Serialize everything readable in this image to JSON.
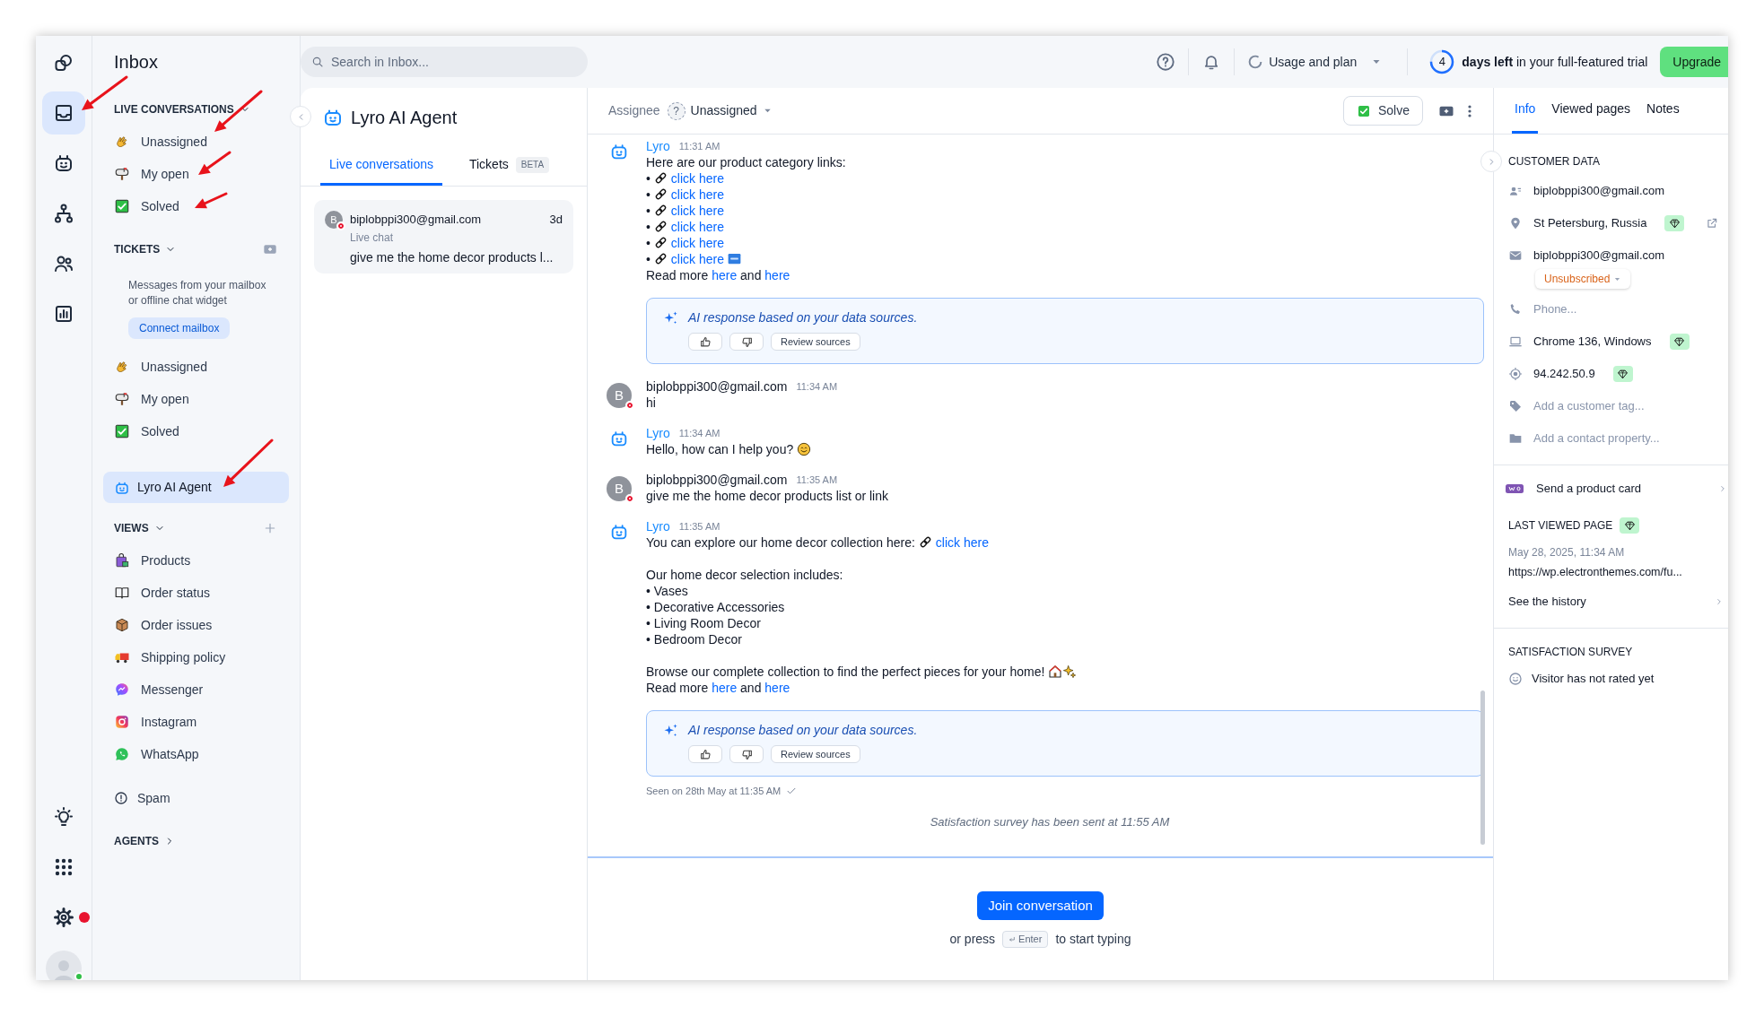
{
  "rail": {
    "top": [
      {
        "kind": "shapes",
        "selected": false
      },
      {
        "kind": "inbox",
        "selected": true
      },
      {
        "kind": "robot",
        "selected": false
      },
      {
        "kind": "flow",
        "selected": false
      },
      {
        "kind": "contacts",
        "selected": false
      },
      {
        "kind": "chart",
        "selected": false
      }
    ],
    "bottom": [
      {
        "kind": "bulb",
        "selected": false,
        "alert": false
      },
      {
        "kind": "apps",
        "selected": false,
        "alert": false
      },
      {
        "kind": "gear",
        "selected": false,
        "alert": true
      }
    ],
    "profile": {
      "online": true
    }
  },
  "sidebar": {
    "title": "Inbox",
    "groups": [
      {
        "kind": "section",
        "heading": "LIVE CONVERSATIONS",
        "expanded": true,
        "items": [
          {
            "label": "Unassigned",
            "kind": "wave",
            "selected": false
          },
          {
            "label": "My open",
            "kind": "mailbox",
            "selected": false
          },
          {
            "label": "Solved",
            "kind": "solved",
            "selected": false
          }
        ]
      },
      {
        "kind": "section",
        "heading": "TICKETS",
        "expanded": true,
        "action": {
          "kind": "add_ticket"
        },
        "note": "Messages from your mailbox or offline chat widget",
        "button": "Connect mailbox",
        "items": [
          {
            "label": "Unassigned",
            "kind": "wave",
            "selected": false
          },
          {
            "label": "My open",
            "kind": "mailbox",
            "selected": false
          },
          {
            "label": "Solved",
            "kind": "solved",
            "selected": false
          }
        ]
      },
      {
        "kind": "agent",
        "label": "Lyro AI Agent",
        "selected": true
      },
      {
        "kind": "section",
        "heading": "VIEWS",
        "expanded": true,
        "action": {
          "kind": "add"
        },
        "items": [
          {
            "label": "Products",
            "kind": "bag",
            "selected": false
          },
          {
            "label": "Order status",
            "kind": "book",
            "selected": false
          },
          {
            "label": "Order issues",
            "kind": "box",
            "selected": false
          },
          {
            "label": "Shipping policy",
            "kind": "truck",
            "selected": false
          },
          {
            "label": "Messenger",
            "kind": "messenger",
            "selected": false
          },
          {
            "label": "Instagram",
            "kind": "instagram",
            "selected": false
          },
          {
            "label": "WhatsApp",
            "kind": "whatsapp",
            "selected": false
          }
        ]
      },
      {
        "kind": "link",
        "label": "Spam"
      },
      {
        "kind": "section",
        "heading": "AGENTS",
        "expanded": false
      }
    ]
  },
  "topbar": {
    "search": {
      "placeholder": "Search in Inbox..."
    },
    "usage": "Usage and plan",
    "trial": {
      "days": "4",
      "level": 0.75,
      "message": "**days left** in your full-featured trial"
    },
    "upgrade": "Upgrade"
  },
  "list": {
    "title": "Lyro AI Agent",
    "tabs": [
      {
        "label": "Live conversations",
        "selected": true
      },
      {
        "label": "Tickets",
        "badge": "BETA",
        "selected": false
      }
    ],
    "conversations": [
      {
        "avatar": "B",
        "online": false,
        "name": "biplobppi300@gmail.com",
        "time": "3d",
        "channel": "Live chat",
        "preview": "give me the home decor products l...",
        "selected": true
      }
    ]
  },
  "chat": {
    "assignee": {
      "label": "Assignee",
      "avatar": "?",
      "value": "Unassigned"
    },
    "solve": "Solve",
    "messages": [
      {
        "kind": "bot",
        "author": "Lyro",
        "time": "11:31 AM",
        "paragraphs": [
          [
            [
              {
                "kind": "text",
                "text": "Here are our product category links:"
              }
            ],
            [
              {
                "kind": "text",
                "text": "• "
              },
              {
                "kind": "chain"
              },
              {
                "kind": "link",
                "text": "click here"
              }
            ],
            [
              {
                "kind": "text",
                "text": "• "
              },
              {
                "kind": "chain"
              },
              {
                "kind": "link",
                "text": "click here"
              }
            ],
            [
              {
                "kind": "text",
                "text": "• "
              },
              {
                "kind": "chain"
              },
              {
                "kind": "link",
                "text": "click here"
              }
            ],
            [
              {
                "kind": "text",
                "text": "• "
              },
              {
                "kind": "chain"
              },
              {
                "kind": "link",
                "text": "click here"
              }
            ],
            [
              {
                "kind": "text",
                "text": "• "
              },
              {
                "kind": "chain"
              },
              {
                "kind": "link",
                "text": "click here"
              }
            ],
            [
              {
                "kind": "text",
                "text": "• "
              },
              {
                "kind": "chain"
              },
              {
                "kind": "link",
                "text": "click here"
              },
              {
                "kind": "new"
              }
            ],
            [
              {
                "kind": "text",
                "text": "Read more "
              },
              {
                "kind": "link",
                "text": "here"
              },
              {
                "kind": "text",
                "text": " and "
              },
              {
                "kind": "link",
                "text": "here"
              }
            ]
          ]
        ]
      },
      {
        "kind": "ai_note",
        "text": "AI response based on your data sources.",
        "button": "Review sources"
      },
      {
        "kind": "visitor",
        "author": "biplobppi300@gmail.com",
        "time": "11:34 AM",
        "avatar": "B",
        "online": false,
        "paragraphs": [
          [
            [
              {
                "kind": "text",
                "text": "hi"
              }
            ]
          ]
        ]
      },
      {
        "kind": "bot",
        "author": "Lyro",
        "time": "11:34 AM",
        "paragraphs": [
          [
            [
              {
                "kind": "text",
                "text": "Hello, how can I help you? "
              },
              {
                "kind": "smile"
              }
            ]
          ]
        ]
      },
      {
        "kind": "visitor",
        "author": "biplobppi300@gmail.com",
        "time": "11:35 AM",
        "avatar": "B",
        "online": false,
        "paragraphs": [
          [
            [
              {
                "kind": "text",
                "text": "give me the home decor products list or link"
              }
            ]
          ]
        ]
      },
      {
        "kind": "bot",
        "author": "Lyro",
        "time": "11:35 AM",
        "paragraphs": [
          [
            [
              {
                "kind": "text",
                "text": "You can explore our home decor collection here: "
              },
              {
                "kind": "chain"
              },
              {
                "kind": "link",
                "text": "click here"
              }
            ]
          ],
          [
            [
              {
                "kind": "text",
                "text": "Our home decor selection includes:"
              }
            ],
            [
              {
                "kind": "text",
                "text": "• Vases"
              }
            ],
            [
              {
                "kind": "text",
                "text": "• Decorative Accessories"
              }
            ],
            [
              {
                "kind": "text",
                "text": "• Living Room Decor"
              }
            ],
            [
              {
                "kind": "text",
                "text": "• Bedroom Decor"
              }
            ]
          ],
          [
            [
              {
                "kind": "text",
                "text": "Browse our complete collection to find the perfect pieces for your home! "
              },
              {
                "kind": "house"
              },
              {
                "kind": "sparkles"
              }
            ],
            [
              {
                "kind": "text",
                "text": "Read more "
              },
              {
                "kind": "link",
                "text": "here"
              },
              {
                "kind": "text",
                "text": " and "
              },
              {
                "kind": "link",
                "text": "here"
              }
            ]
          ]
        ]
      },
      {
        "kind": "ai_note",
        "text": "AI response based on your data sources.",
        "button": "Review sources"
      },
      {
        "kind": "seen",
        "text": "Seen on 28th May at 11:35 AM"
      },
      {
        "kind": "system",
        "text": "Satisfaction survey has been sent at 11:55 AM"
      }
    ],
    "composer": {
      "join": "Join conversation",
      "hint_before": "or press",
      "key": "Enter",
      "hint_after": "to start typing"
    }
  },
  "details": {
    "tabs": [
      {
        "label": "Info",
        "selected": true
      },
      {
        "label": "Viewed pages",
        "selected": false
      },
      {
        "label": "Notes",
        "selected": false
      }
    ],
    "customer_heading": "CUSTOMER DATA",
    "rows": [
      {
        "kind": "person",
        "text": "biplobppi300@gmail.com",
        "muted": false,
        "premium": false
      },
      {
        "kind": "pin",
        "text": "St Petersburg, Russia",
        "muted": false,
        "premium": true,
        "external": true
      },
      {
        "kind": "mail",
        "text": "biplobppi300@gmail.com",
        "muted": false,
        "premium": false,
        "status": "Unsubscribed"
      },
      {
        "kind": "phone",
        "text": "Phone...",
        "muted": true,
        "premium": false
      },
      {
        "kind": "laptop",
        "text": "Chrome 136, Windows",
        "muted": false,
        "premium": true
      },
      {
        "kind": "target",
        "text": "94.242.50.9",
        "muted": false,
        "premium": true
      },
      {
        "kind": "tag",
        "text": "Add a customer tag...",
        "muted": true,
        "premium": false
      },
      {
        "kind": "folder",
        "text": "Add a contact property...",
        "muted": true,
        "premium": false
      }
    ],
    "product_card": "Send a product card",
    "last_viewed": {
      "heading": "LAST VIEWED PAGE",
      "premium": true,
      "date": "May 28, 2025, 11:34 AM",
      "url": "https://wp.electronthemes.com/fu...",
      "history": "See the history"
    },
    "survey": {
      "heading": "SATISFACTION SURVEY",
      "text": "Visitor has not rated yet"
    }
  }
}
